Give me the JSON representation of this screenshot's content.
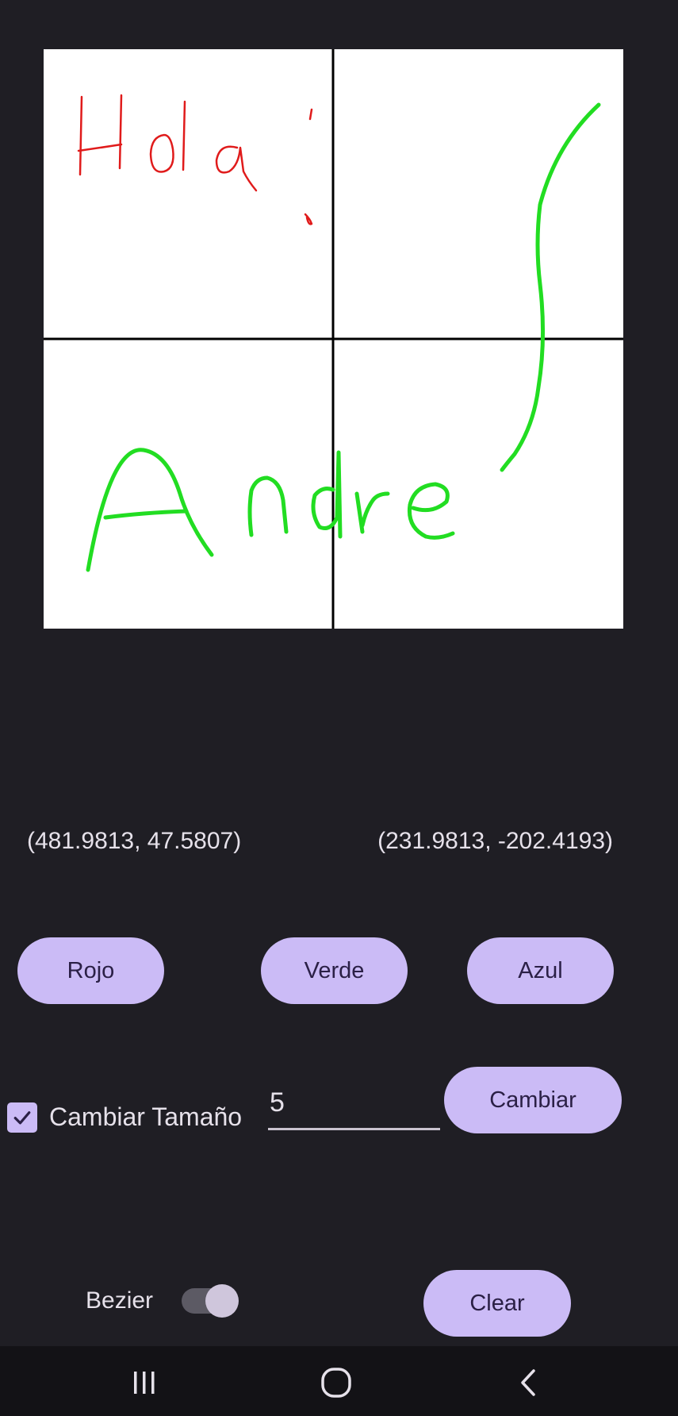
{
  "coordinates": {
    "left": "(481.9813, 47.5807)",
    "right": "(231.9813, -202.4193)"
  },
  "color_buttons": {
    "red": "Rojo",
    "green": "Verde",
    "blue": "Azul"
  },
  "size_control": {
    "checkbox_label": "Cambiar Tamaño",
    "checked": true,
    "value": "5",
    "apply_label": "Cambiar"
  },
  "bezier": {
    "label": "Bezier",
    "enabled": true
  },
  "clear_label": "Clear",
  "drawing": {
    "strokes": [
      {
        "color": "#e01b1b",
        "text": "Hola!"
      },
      {
        "color": "#22dd22",
        "text": "Andre"
      }
    ]
  },
  "colors": {
    "background": "#1f1e24",
    "button": "#cbbbf6",
    "button_text": "#2b2046",
    "stroke_red": "#e01b1b",
    "stroke_green": "#22dd22",
    "navbar": "#131216"
  },
  "navigation": {
    "icons": [
      "recents-icon",
      "home-icon",
      "back-icon"
    ]
  }
}
